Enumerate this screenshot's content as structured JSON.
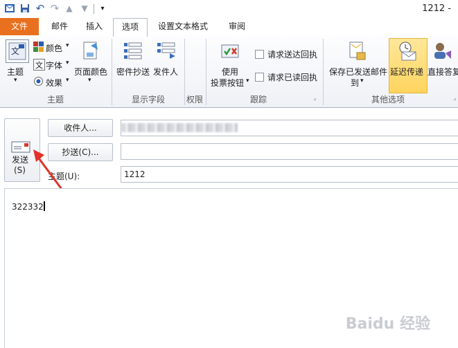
{
  "window": {
    "title": "1212 -"
  },
  "quick_access": {
    "icons": [
      "outlook-icon",
      "save-icon",
      "undo-icon",
      "redo-icon",
      "up-arrow-icon",
      "down-arrow-icon",
      "customize-icon"
    ]
  },
  "tabs": [
    {
      "label": "文件"
    },
    {
      "label": "邮件"
    },
    {
      "label": "插入"
    },
    {
      "label": "选项"
    },
    {
      "label": "设置文本格式"
    },
    {
      "label": "审阅"
    }
  ],
  "ribbon": {
    "themes": {
      "theme_label": "主题",
      "colors_label": "颜色",
      "fonts_label": "字体",
      "effects_label": "效果",
      "page_color_label": "页面颜色",
      "group_label": "主题"
    },
    "show_fields": {
      "bcc_label": "密件抄送",
      "from_label": "发件人",
      "group_label": "显示字段"
    },
    "permission": {
      "group_label": "权限"
    },
    "tracking": {
      "voting_line1": "使用",
      "voting_line2": "投票按钮",
      "delivery_receipt": "请求送达回执",
      "read_receipt": "请求已读回执",
      "group_label": "跟踪"
    },
    "more_options": {
      "save_sent_line1": "保存已发送邮件",
      "save_sent_line2": "到",
      "delay_label": "延迟传递",
      "direct_reply_label": "直接答复",
      "group_label": "其他选项"
    }
  },
  "compose": {
    "send_label": "发送",
    "send_shortcut": "(S)",
    "to_button": "收件人...",
    "to_value": "",
    "cc_button": "抄送(C)...",
    "cc_value": "",
    "subject_label": "主题(U):",
    "subject_value": "1212",
    "body_text": "322332"
  },
  "watermark": "Baidu 经验",
  "colors": {
    "file_tab": "#e8701e",
    "delay_highlight": "#ffd45e",
    "arrow": "#e2322b"
  }
}
